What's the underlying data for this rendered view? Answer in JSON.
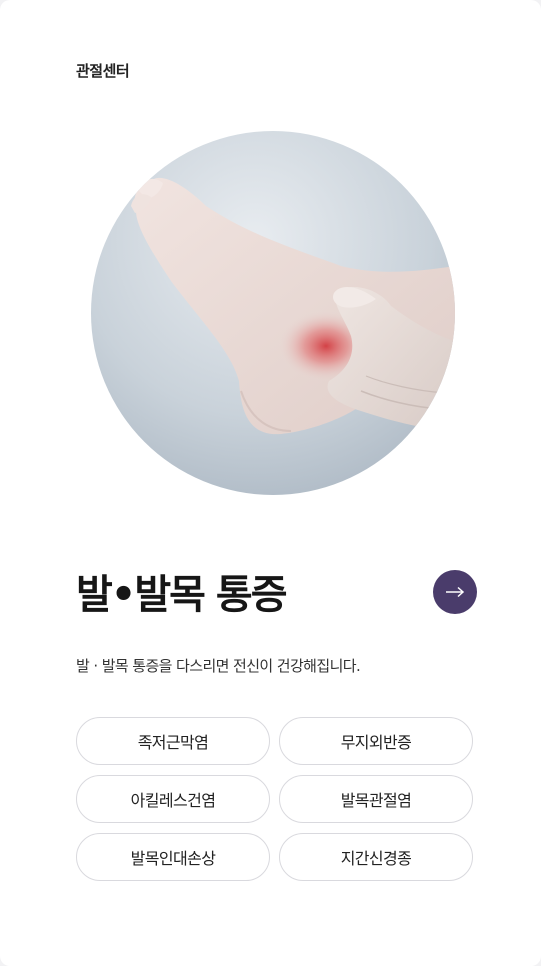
{
  "category": "관절센터",
  "hero": {
    "image": "foot-ankle-pain-photo",
    "colors": {
      "background": "#c4cdd5",
      "skin": "#eadcd8",
      "pain": "#d23a3f"
    }
  },
  "title": "발•발목 통증",
  "arrow_button": {
    "icon": "arrow-right-icon",
    "color": "#4a3c6b"
  },
  "description": "발 · 발목 통증을 다스리면 전신이 건강해집니다.",
  "tags": [
    {
      "label": "족저근막염"
    },
    {
      "label": "무지외반증"
    },
    {
      "label": "아킬레스건염"
    },
    {
      "label": "발목관절염"
    },
    {
      "label": "발목인대손상"
    },
    {
      "label": "지간신경종"
    }
  ]
}
